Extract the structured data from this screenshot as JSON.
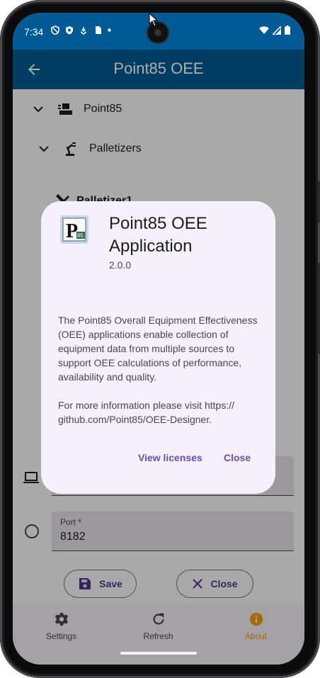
{
  "status_bar": {
    "time": "7:34",
    "left_icons": [
      "shield-outline-icon",
      "shield-check-icon",
      "download-shield-icon",
      "sim-card-icon",
      "dot-icon"
    ],
    "right_icons": [
      "wifi-icon",
      "signal-icon",
      "battery-icon"
    ]
  },
  "app_bar": {
    "title": "Point85 OEE",
    "back_icon": "arrow-back-icon",
    "color": "#015a93"
  },
  "tree": {
    "root": {
      "label": "Point85",
      "icon": "plant-icon"
    },
    "child": {
      "label": "Palletizers",
      "icon": "robot-arm-icon"
    },
    "grandchild": {
      "label": "Palletizer1",
      "icon": "tools-icon"
    }
  },
  "form": {
    "port": {
      "label": "Port *",
      "value": "8182"
    },
    "save_label": "Save",
    "close_label": "Close"
  },
  "bottom_nav": {
    "items": [
      {
        "label": "Settings",
        "icon": "gear-icon"
      },
      {
        "label": "Refresh",
        "icon": "refresh-icon"
      },
      {
        "label": "About",
        "icon": "info-icon",
        "active": true
      }
    ],
    "active_color": "#f59e0b"
  },
  "dialog": {
    "logo_text": "P",
    "logo_subtext": "85",
    "title": "Point85 OEE Application",
    "version": "2.0.0",
    "body_1": "The Point85 Overall Equipment Effectiveness (OEE) applications enable collection of equipment data from multiple sources to support OEE calculations of performance, availability and quality.",
    "body_2": "For more information please visit https:// github.com/Point85/OEE-Designer.",
    "view_licenses_label": "View licenses",
    "close_label": "Close"
  }
}
